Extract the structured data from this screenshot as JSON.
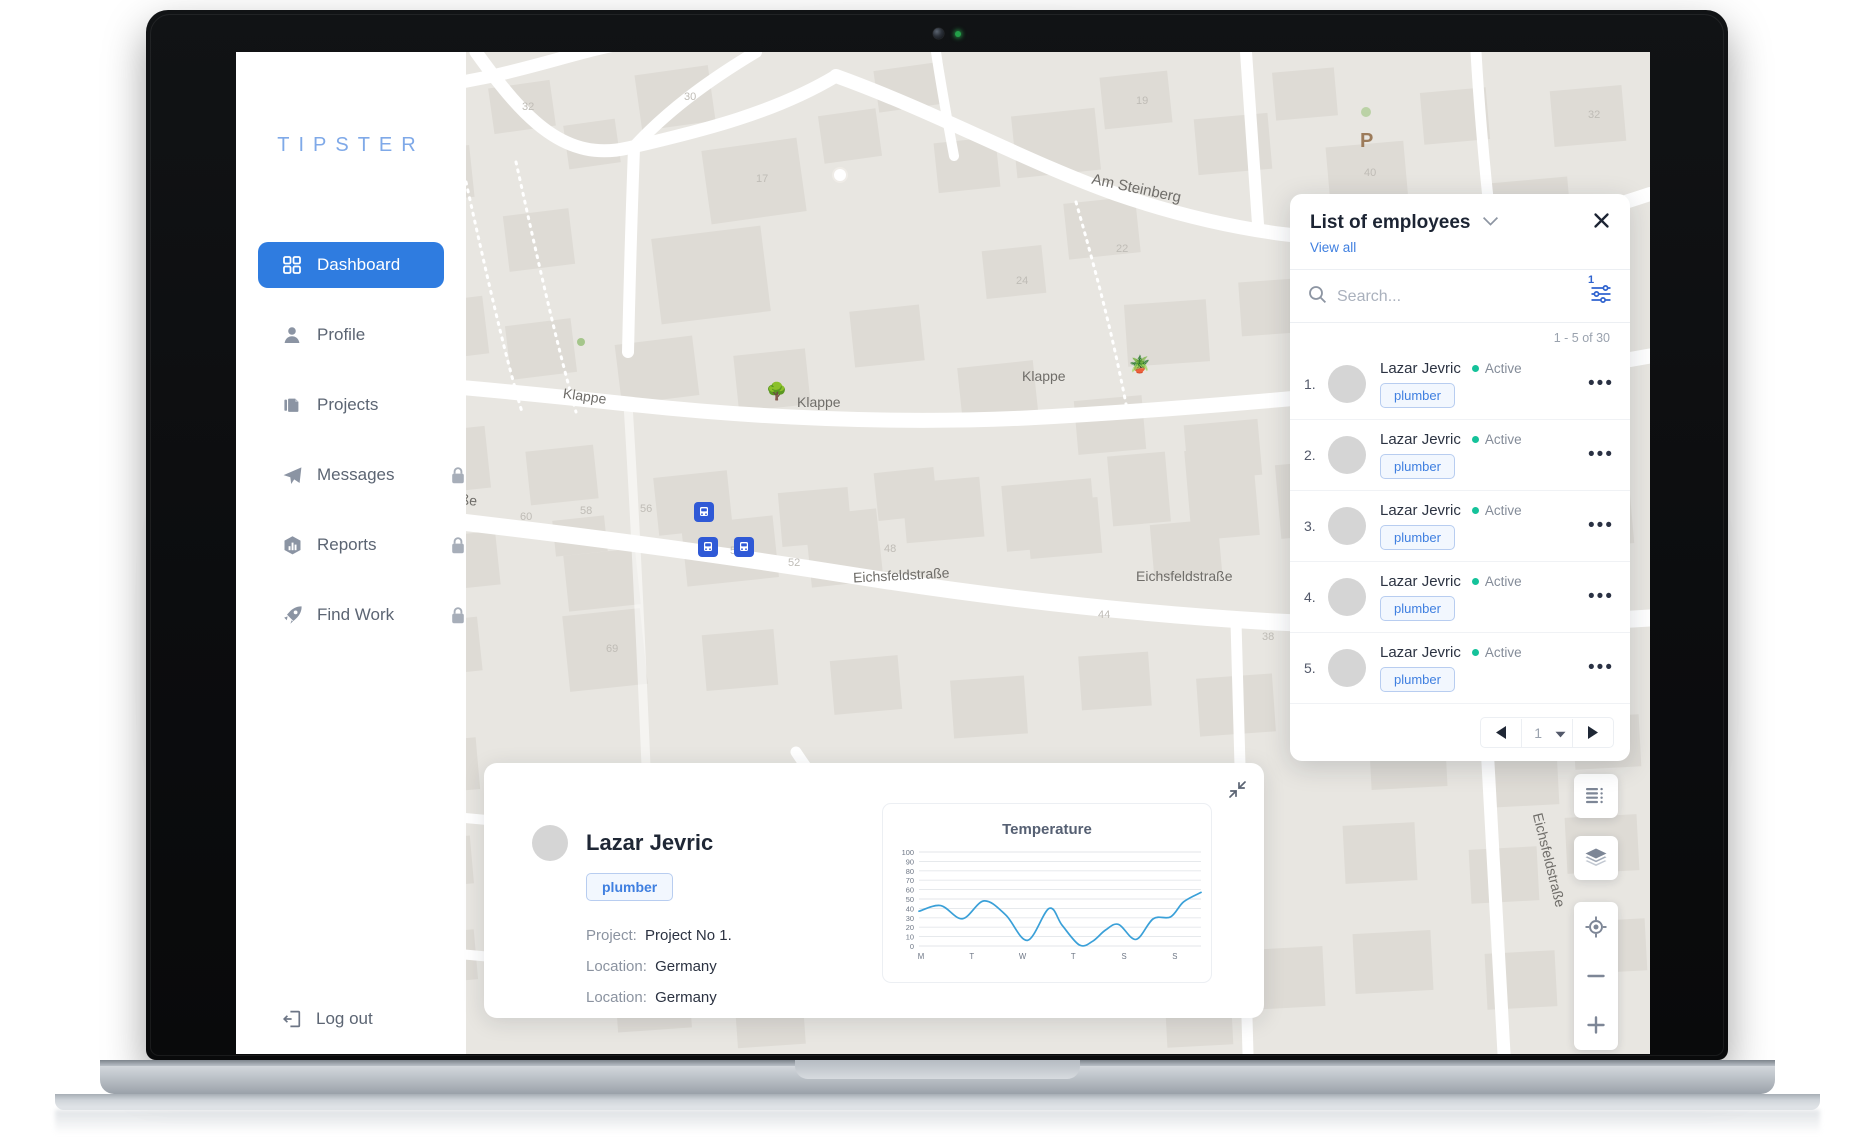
{
  "brand": {
    "logo": "TIPSTER"
  },
  "sidebar": {
    "items": [
      {
        "label": "Dashboard",
        "icon": "grid-icon",
        "active": true,
        "locked": false
      },
      {
        "label": "Profile",
        "icon": "person-icon",
        "active": false,
        "locked": false
      },
      {
        "label": "Projects",
        "icon": "documents-icon",
        "active": false,
        "locked": false
      },
      {
        "label": "Messages",
        "icon": "paper-plane-icon",
        "active": false,
        "locked": true
      },
      {
        "label": "Reports",
        "icon": "chart-hexagon-icon",
        "active": false,
        "locked": true
      },
      {
        "label": "Find Work",
        "icon": "rocket-icon",
        "active": false,
        "locked": true
      }
    ],
    "logout": {
      "label": "Log out",
      "icon": "logout-icon"
    }
  },
  "employees_panel": {
    "title": "List of employees",
    "view_all": "View all",
    "collapse_icon": "chevron-down-icon",
    "close_icon": "close-icon",
    "search": {
      "placeholder": "Search...",
      "value": "",
      "icon": "search-icon"
    },
    "filter": {
      "icon": "filter-sliders-icon",
      "badge": "1"
    },
    "count_label": "1 - 5 of  30",
    "rows": [
      {
        "index": "1.",
        "name": "Lazar Jevric",
        "status": "Active",
        "role": "plumber"
      },
      {
        "index": "2.",
        "name": "Lazar Jevric",
        "status": "Active",
        "role": "plumber"
      },
      {
        "index": "3.",
        "name": "Lazar Jevric",
        "status": "Active",
        "role": "plumber"
      },
      {
        "index": "4.",
        "name": "Lazar Jevric",
        "status": "Active",
        "role": "plumber"
      },
      {
        "index": "5.",
        "name": "Lazar Jevric",
        "status": "Active",
        "role": "plumber"
      }
    ],
    "pagination": {
      "page": "1",
      "prev_icon": "triangle-left-icon",
      "next_icon": "triangle-right-icon"
    },
    "status_color": "#15c29a",
    "accent_color": "#3f7fe0"
  },
  "detail_card": {
    "collapse_icon": "collapse-diagonal-icon",
    "name": "Lazar Jevric",
    "role": "plumber",
    "fields": [
      {
        "key": "Project:",
        "value": "Project No 1."
      },
      {
        "key": "Location:",
        "value": "Germany"
      },
      {
        "key": "Location:",
        "value": "Germany"
      }
    ]
  },
  "chart_data": {
    "type": "line",
    "title": "Temperature",
    "xlabel": "",
    "ylabel": "",
    "ylim": [
      0,
      100
    ],
    "yticks": [
      100,
      90,
      80,
      70,
      60,
      50,
      40,
      30,
      20,
      10,
      0
    ],
    "categories": [
      "M",
      "T",
      "W",
      "T",
      "S",
      "S"
    ],
    "grid": true,
    "legend": "none",
    "line_color": "#3aa0d8",
    "x": [
      0,
      0.5,
      1.0,
      1.5,
      2.0,
      2.5,
      3.0,
      3.3,
      3.7,
      4.0,
      4.3,
      4.6,
      5.0,
      5.4,
      5.8,
      6.1,
      6.5
    ],
    "values": [
      37,
      43,
      29,
      48,
      33,
      6,
      40,
      22,
      1,
      5,
      17,
      23,
      7,
      29,
      31,
      47,
      57
    ]
  },
  "map": {
    "street_labels": [
      {
        "text": "Am Steinberg"
      },
      {
        "text": "Klappe"
      },
      {
        "text": "Klappe"
      },
      {
        "text": "Klappe"
      },
      {
        "text": "Eichsfeldstraße"
      },
      {
        "text": "Eichsfeldstraße"
      },
      {
        "text": "Eichsfeldstraße"
      },
      {
        "text": "Eichsfeldstraße"
      }
    ],
    "parking_label": "P",
    "transit_markers": 3,
    "controls": [
      {
        "name": "list-view-button",
        "icon": "list-icon"
      },
      {
        "name": "layers-button",
        "icon": "layers-icon"
      },
      {
        "name": "locate-button",
        "icon": "crosshair-icon"
      },
      {
        "name": "zoom-out-button",
        "icon": "minus-icon"
      },
      {
        "name": "zoom-in-button",
        "icon": "plus-icon"
      }
    ]
  }
}
